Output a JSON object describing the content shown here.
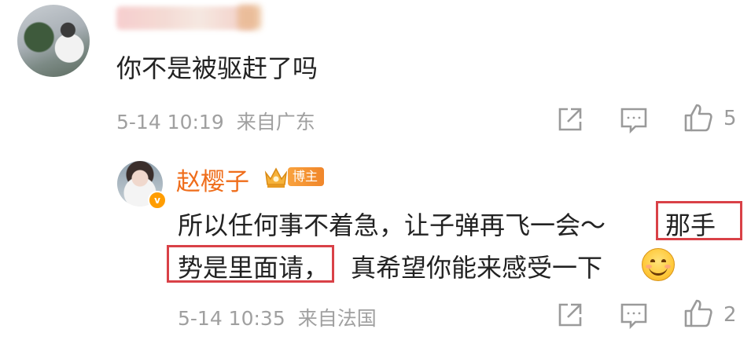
{
  "comment": {
    "text": "你不是被驱赶了吗",
    "time": "5-14 10:19",
    "location": "来自广东",
    "like_count": "5"
  },
  "reply": {
    "author": "赵樱子",
    "badge": "博主",
    "line1_plain": "所以任何事不着急，让子弹再飞一会～",
    "line1_highlight": "那手",
    "line2_highlight": "势是里面请，",
    "line2_plain": "真希望你能来感受一下",
    "time": "5-14 10:35",
    "location": "来自法国",
    "like_count": "2"
  },
  "icons": {
    "share": "share-icon",
    "comment": "comment-icon",
    "like": "thumbs-up-icon",
    "emoji": "smile-emoji-icon",
    "badge": "crown-icon",
    "verified": "verified-v-icon"
  },
  "colors": {
    "author_name": "#ef6d1b",
    "highlight_box": "#d94147",
    "meta_text": "#a0a0a0"
  }
}
